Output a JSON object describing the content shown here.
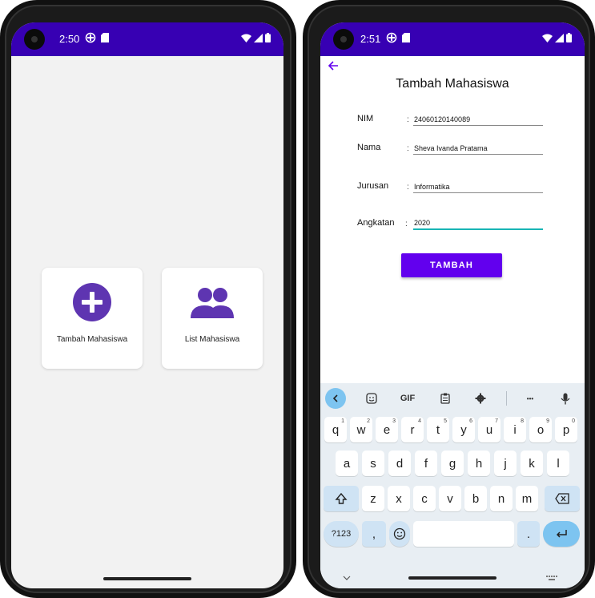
{
  "left_screen": {
    "status": {
      "time": "2:50"
    },
    "cards": [
      {
        "label": "Tambah Mahasiswa",
        "icon": "add-circle-icon"
      },
      {
        "label": "List Mahasiswa",
        "icon": "people-icon"
      }
    ]
  },
  "right_screen": {
    "status": {
      "time": "2:51"
    },
    "title": "Tambah Mahasiswa",
    "fields": [
      {
        "label": "NIM",
        "value": "24060120140089"
      },
      {
        "label": "Nama",
        "value": "Sheva Ivanda Pratama"
      },
      {
        "label": "Jurusan",
        "value": "Informatika"
      },
      {
        "label": "Angkatan",
        "value": "2020"
      }
    ],
    "colon": ":",
    "submit_label": "TAMBAH",
    "keyboard": {
      "gif_label": "GIF",
      "more_label": "•••",
      "row1": [
        {
          "k": "q",
          "n": "1"
        },
        {
          "k": "w",
          "n": "2"
        },
        {
          "k": "e",
          "n": "3"
        },
        {
          "k": "r",
          "n": "4"
        },
        {
          "k": "t",
          "n": "5"
        },
        {
          "k": "y",
          "n": "6"
        },
        {
          "k": "u",
          "n": "7"
        },
        {
          "k": "i",
          "n": "8"
        },
        {
          "k": "o",
          "n": "9"
        },
        {
          "k": "p",
          "n": "0"
        }
      ],
      "row2": [
        "a",
        "s",
        "d",
        "f",
        "g",
        "h",
        "j",
        "k",
        "l"
      ],
      "row3": [
        "z",
        "x",
        "c",
        "v",
        "b",
        "n",
        "m"
      ],
      "sym_label": "?123",
      "comma_label": ",",
      "period_label": "."
    }
  },
  "colors": {
    "status_bar": "#3700b3",
    "accent": "#6200ee",
    "icon_purple": "#5e35b1",
    "focus_line": "#18b5b5"
  }
}
